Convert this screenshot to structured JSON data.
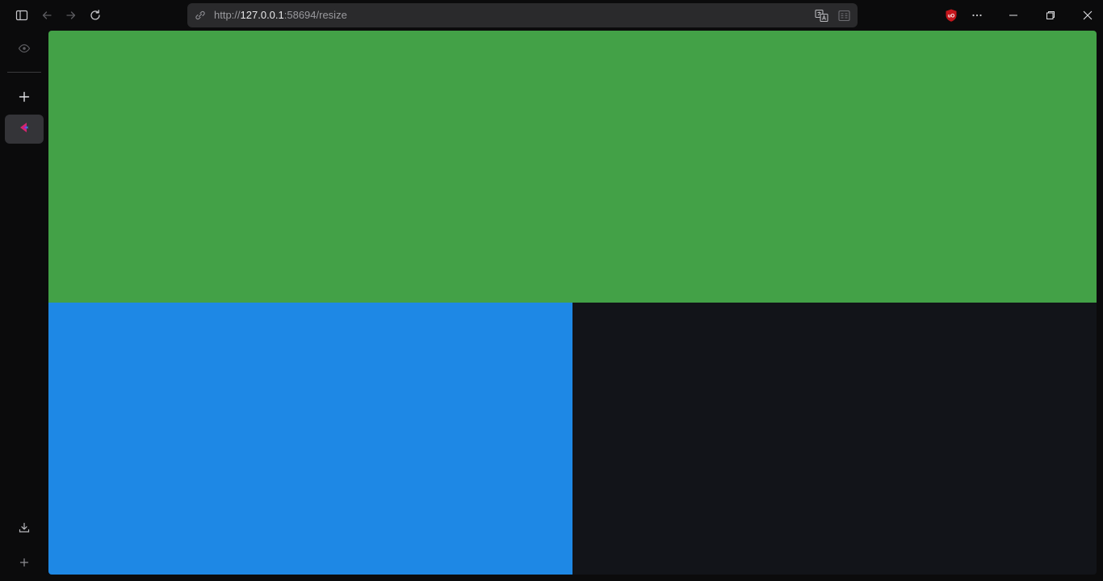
{
  "browser": {
    "url_scheme": "http://",
    "url_host": "127.0.0.1",
    "url_rest": ":58694/resize"
  },
  "colors": {
    "panel_top": "#43a147",
    "panel_bottom_left": "#1e88e5",
    "panel_bottom_right": "#121419",
    "chrome_background": "#0b0b0c",
    "urlbar_background": "#2a2a2c",
    "ublock_badge": "#c4161c"
  },
  "icons": {
    "toolbar": [
      "sidebar-toggle-icon",
      "back-icon",
      "forward-icon",
      "reload-icon"
    ],
    "urlbar": [
      "site-info-icon",
      "translate-icon",
      "reader-view-icon"
    ],
    "extensions": [
      "ublock-origin-icon",
      "more-options-icon"
    ],
    "window": [
      "minimize-icon",
      "restore-icon",
      "close-icon"
    ],
    "sidebar": [
      "preview-eye-icon",
      "new-tab-plus-icon",
      "active-app-icon",
      "downloads-icon",
      "add-panel-plus-icon"
    ]
  }
}
